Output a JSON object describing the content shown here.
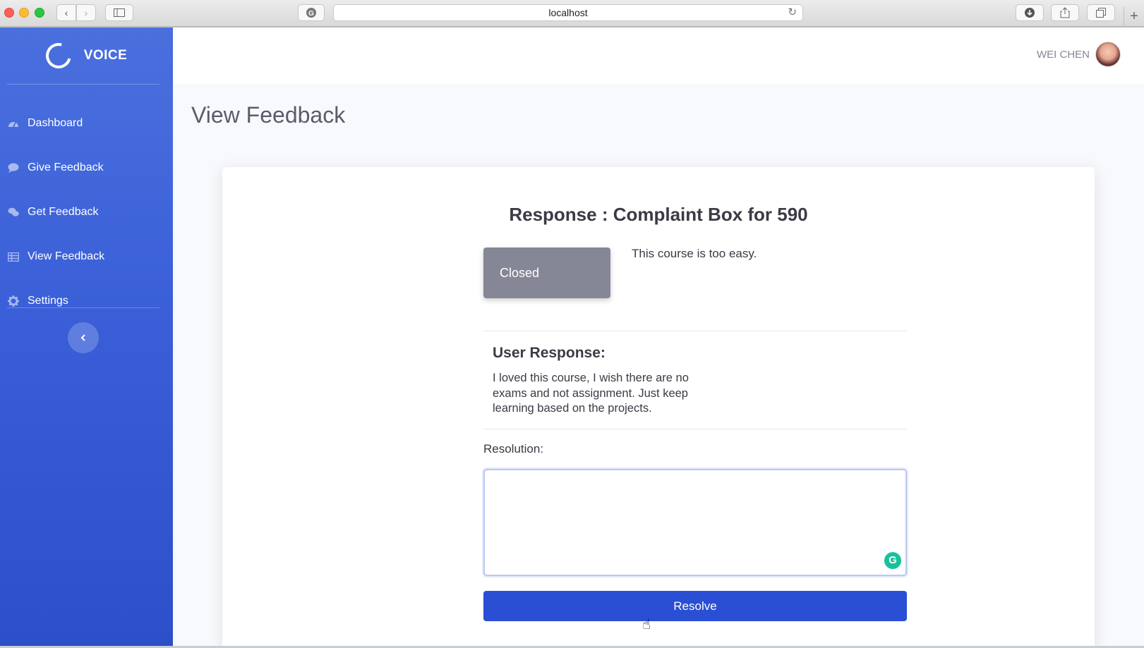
{
  "browser": {
    "url": "localhost",
    "icons": {
      "back": "chevron-left-icon",
      "forward": "chevron-right-icon",
      "sidebar": "sidebar-icon",
      "reload": "reload-icon",
      "download": "download-icon",
      "share": "share-icon",
      "tabs": "tabs-icon",
      "new_tab": "plus-icon"
    }
  },
  "sidebar": {
    "brand": "VOICE",
    "items": [
      {
        "label": "Dashboard",
        "icon": "dashboard-icon"
      },
      {
        "label": "Give Feedback",
        "icon": "comment-icon"
      },
      {
        "label": "Get Feedback",
        "icon": "comments-icon"
      },
      {
        "label": "View Feedback",
        "icon": "table-icon"
      },
      {
        "label": "Settings",
        "icon": "gear-icon"
      }
    ],
    "collapse_icon": "chevron-left-icon",
    "gradient": [
      "#4a70de",
      "#2c4fca"
    ]
  },
  "topbar": {
    "user_name": "WEI CHEN"
  },
  "page": {
    "title": "View Feedback"
  },
  "response": {
    "title": "Response : Complaint Box for 590",
    "status": "Closed",
    "status_color": "#858796",
    "feedback_text": "This course is too easy.",
    "user_response_title": "User Response:",
    "user_response_text": "I loved this course, I wish there are no exams and not assignment. Just keep learning based on the projects.",
    "resolution_label": "Resolution:",
    "resolution_value": "",
    "resolve_button": "Resolve",
    "resolve_color": "#2a4fd4"
  }
}
